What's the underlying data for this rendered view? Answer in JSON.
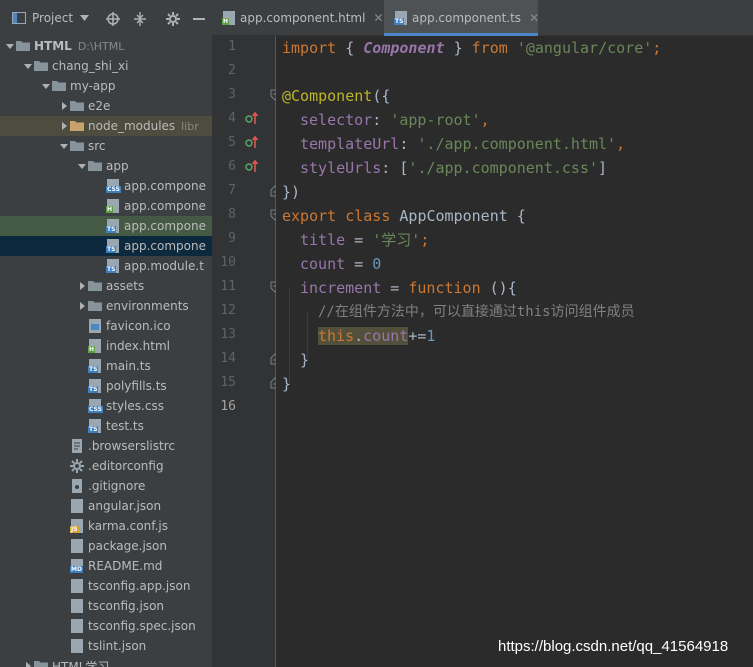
{
  "colors": {
    "panel_bg": "#3c3f41",
    "editor_bg": "#2b2b2b",
    "gutter_bg": "#313335",
    "keyword": "#cc7832",
    "string": "#6a8759",
    "property": "#9876aa",
    "number": "#6897bb",
    "decorator": "#bbb529",
    "comment": "#808080",
    "active_tab_underline": "#4a88c7"
  },
  "panel_header": {
    "title": "Project",
    "icons": [
      "project-icon",
      "dropdown-icon",
      "locate-icon",
      "collapse-icon",
      "gear-icon",
      "minimize-icon"
    ]
  },
  "tree": [
    {
      "label": "HTML",
      "path": "D:\\HTML",
      "icon": "folder-icon",
      "expanded": true
    },
    {
      "label": "chang_shi_xi",
      "icon": "folder-icon",
      "expanded": true
    },
    {
      "label": "my-app",
      "icon": "folder-icon",
      "expanded": true
    },
    {
      "label": "e2e",
      "icon": "folder-icon",
      "expanded": false
    },
    {
      "label": "node_modules",
      "path": "libr",
      "icon": "folder-excluded-icon",
      "expanded": false
    },
    {
      "label": "src",
      "icon": "folder-icon",
      "expanded": true
    },
    {
      "label": "app",
      "icon": "folder-icon",
      "expanded": true
    },
    {
      "label": "app.compone",
      "icon": "css-file-icon"
    },
    {
      "label": "app.compone",
      "icon": "html-file-icon"
    },
    {
      "label": "app.compone",
      "icon": "ts-file-icon"
    },
    {
      "label": "app.compone",
      "icon": "ts-file-icon"
    },
    {
      "label": "app.module.t",
      "icon": "ts-file-icon"
    },
    {
      "label": "assets",
      "icon": "folder-icon",
      "expanded": false
    },
    {
      "label": "environments",
      "icon": "folder-icon",
      "expanded": false
    },
    {
      "label": "favicon.ico",
      "icon": "image-file-icon"
    },
    {
      "label": "index.html",
      "icon": "html-file-icon"
    },
    {
      "label": "main.ts",
      "icon": "ts-file-icon"
    },
    {
      "label": "polyfills.ts",
      "icon": "ts-file-icon"
    },
    {
      "label": "styles.css",
      "icon": "css-file-icon"
    },
    {
      "label": "test.ts",
      "icon": "ts-file-icon"
    },
    {
      "label": ".browserslistrc",
      "icon": "text-file-icon"
    },
    {
      "label": ".editorconfig",
      "icon": "gear-file-icon"
    },
    {
      "label": ".gitignore",
      "icon": "git-file-icon"
    },
    {
      "label": "angular.json",
      "icon": "json-file-icon"
    },
    {
      "label": "karma.conf.js",
      "icon": "js-file-icon"
    },
    {
      "label": "package.json",
      "icon": "json-file-icon"
    },
    {
      "label": "README.md",
      "icon": "md-file-icon"
    },
    {
      "label": "tsconfig.app.json",
      "icon": "json-file-icon"
    },
    {
      "label": "tsconfig.json",
      "icon": "json-file-icon"
    },
    {
      "label": "tsconfig.spec.json",
      "icon": "json-file-icon"
    },
    {
      "label": "tslint.json",
      "icon": "json-file-icon"
    },
    {
      "label": "HTML学习",
      "icon": "folder-icon",
      "expanded": false
    }
  ],
  "tabs": [
    {
      "label": "app.component.html",
      "icon": "html-file-icon",
      "active": false
    },
    {
      "label": "app.component.ts",
      "icon": "ts-file-icon",
      "active": true
    }
  ],
  "editor": {
    "current_line": 16,
    "line_numbers": [
      "1",
      "2",
      "3",
      "4",
      "5",
      "6",
      "7",
      "8",
      "9",
      "10",
      "11",
      "12",
      "13",
      "14",
      "15",
      "16"
    ],
    "lines": {
      "l1": {
        "a": "import",
        "b": " { ",
        "c": "Component",
        "d": " } ",
        "e": "from",
        "f": " ",
        "g": "'@angular/core'",
        "h": ";"
      },
      "l3": {
        "a": "@Component",
        "b": "({"
      },
      "l4": {
        "a": "selector",
        "b": ": ",
        "c": "'app-root'",
        "d": ","
      },
      "l5": {
        "a": "templateUrl",
        "b": ": ",
        "c": "'./app.component.html'",
        "d": ","
      },
      "l6": {
        "a": "styleUrls",
        "b": ": [",
        "c": "'./app.component.css'",
        "d": "]"
      },
      "l7": {
        "a": "})"
      },
      "l8": {
        "a": "export",
        "b": " ",
        "c": "class",
        "d": " AppComponent {"
      },
      "l9": {
        "a": "title",
        "b": " = ",
        "c": "'学习'",
        "d": ";"
      },
      "l10": {
        "a": "count",
        "b": " = ",
        "c": "0"
      },
      "l11": {
        "a": "increment",
        "b": " = ",
        "c": "function",
        "d": " (){"
      },
      "l12": {
        "a": "//在组件方法中，可以直接通过this访问组件成员"
      },
      "l13": {
        "a": "this",
        "b": ".",
        "c": "count",
        "d": "+=",
        "e": "1"
      },
      "l14": {
        "a": "}"
      },
      "l15": {
        "a": "}"
      }
    }
  },
  "watermark": "https://blog.csdn.net/qq_41564918"
}
